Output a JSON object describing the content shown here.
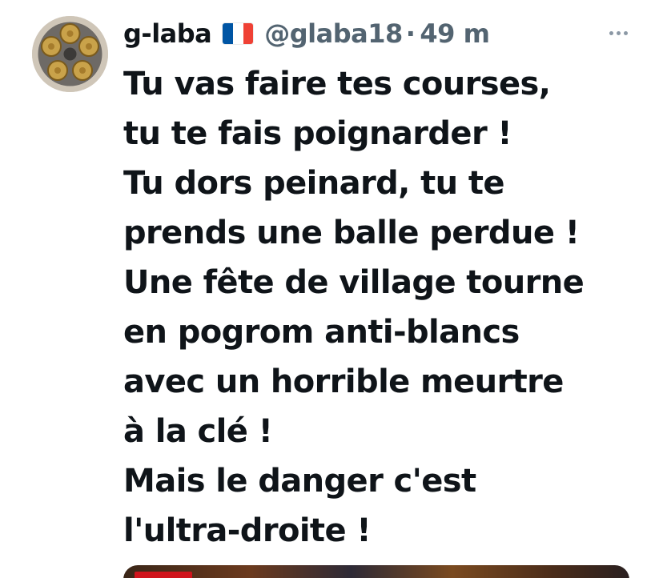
{
  "tweet": {
    "display_name": "g-laba",
    "handle": "@glaba18",
    "separator": "·",
    "time": "49 m",
    "flag_icon": "france-flag-icon",
    "flag_colors": [
      "#0055a4",
      "#ffffff",
      "#ef4135"
    ],
    "avatar_icon": "revolver-cylinder-avatar",
    "more_icon": "more-options-icon",
    "text_lines": [
      "Tu vas faire tes courses,",
      "tu te fais poignarder !",
      "Tu dors peinard, tu te",
      "prends une balle perdue !",
      "Une fête de village tourne",
      "en pogrom anti-blancs",
      "avec un horrible meurtre",
      "à la clé !",
      "Mais le danger c'est",
      "l'ultra-droite !"
    ],
    "media_icon": "news-video-thumbnail"
  }
}
